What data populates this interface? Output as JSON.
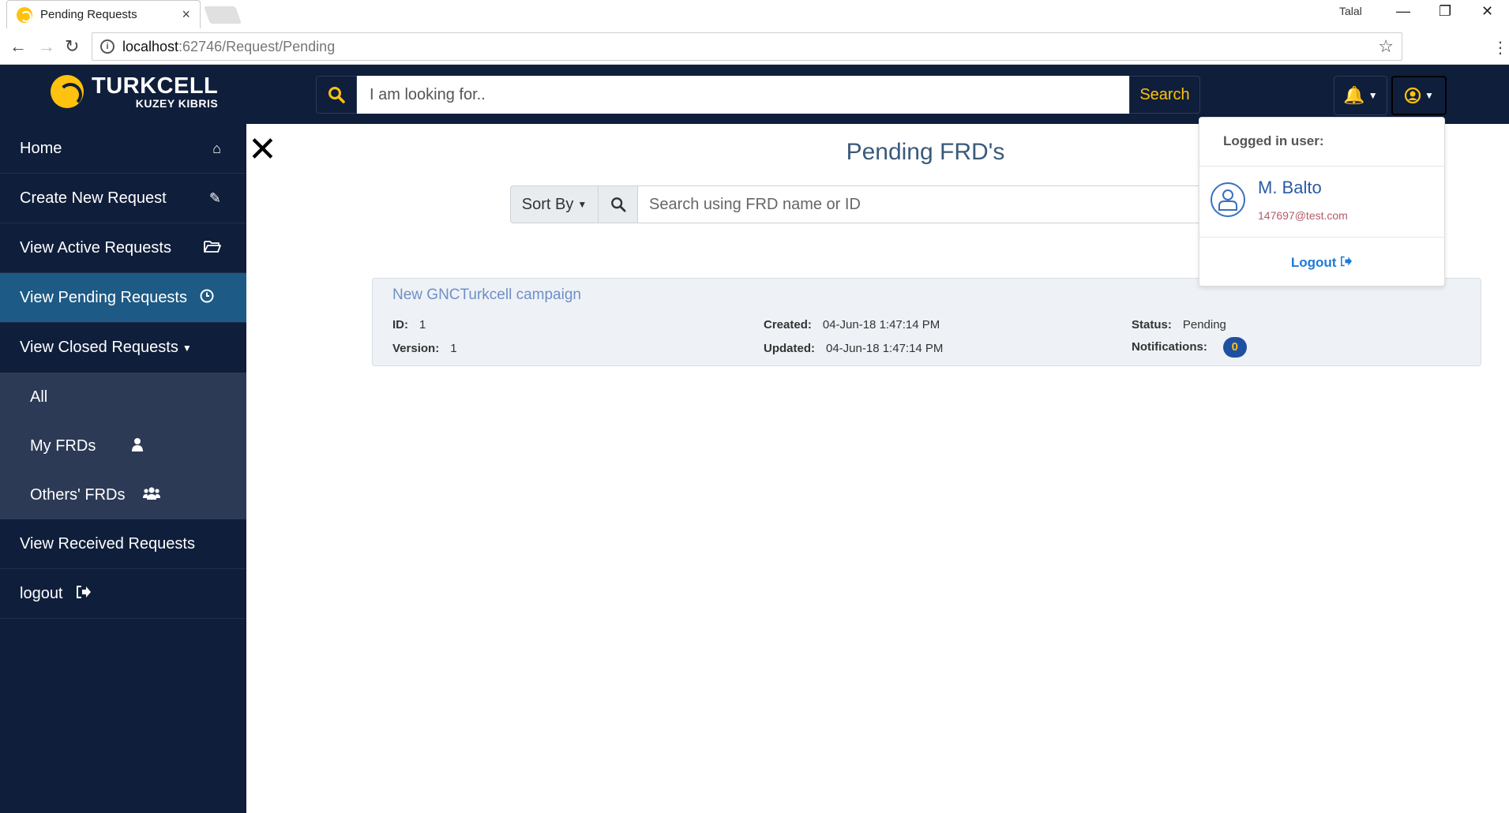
{
  "browser": {
    "tab_title": "Pending Requests",
    "tab_close": "×",
    "window_user": "Talal",
    "url_host": "localhost",
    "url_path": ":62746/Request/Pending"
  },
  "header": {
    "logo_main": "TURKCELL",
    "logo_sub": "KUZEY KIBRIS",
    "search_placeholder": "I am looking for..",
    "search_button": "Search"
  },
  "sidebar": {
    "items": [
      {
        "label": "Home",
        "icon": "home-icon"
      },
      {
        "label": "Create New Request",
        "icon": "edit-icon"
      },
      {
        "label": "View Active Requests",
        "icon": "folder-open-icon"
      },
      {
        "label": "View Pending Requests",
        "icon": "clock-icon"
      },
      {
        "label": "View Closed Requests",
        "icon": "caret-down-icon"
      }
    ],
    "submenu": [
      {
        "label": "All"
      },
      {
        "label": "My FRDs",
        "icon": "user-icon"
      },
      {
        "label": "Others' FRDs",
        "icon": "users-icon"
      }
    ],
    "bottom": [
      {
        "label": "View Received Requests"
      },
      {
        "label": "logout",
        "icon": "sign-out-icon"
      }
    ]
  },
  "main": {
    "close_symbol": "✕",
    "title": "Pending FRD's",
    "sort_label": "Sort By",
    "filter_placeholder": "Search using FRD name or ID",
    "card": {
      "title": "New GNCTurkcell campaign",
      "id_label": "ID:",
      "id_value": "1",
      "version_label": "Version:",
      "version_value": "1",
      "created_label": "Created:",
      "created_value": "04-Jun-18 1:47:14 PM",
      "updated_label": "Updated:",
      "updated_value": "04-Jun-18 1:47:14 PM",
      "status_label": "Status:",
      "status_value": "Pending",
      "notifications_label": "Notifications:",
      "notifications_value": "0"
    }
  },
  "user_dropdown": {
    "header": "Logged in user:",
    "name": "M. Balto",
    "email": "147697@test.com",
    "logout": "Logout"
  },
  "colors": {
    "navy": "#0f1e3a",
    "accent_yellow": "#ffc20e",
    "active_blue": "#1d5a85",
    "submenu_bg": "#2c3a56"
  }
}
